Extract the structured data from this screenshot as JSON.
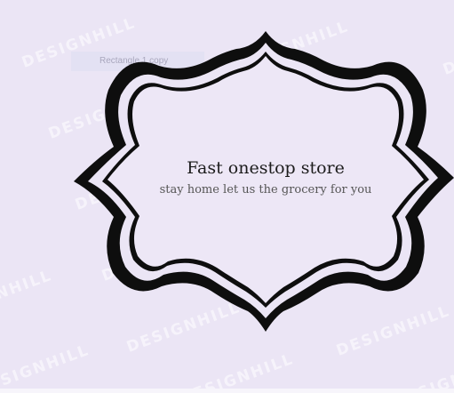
{
  "colors": {
    "background": "#ebe5f5",
    "frame": "#0e0e0e",
    "inner": "#ede7f6"
  },
  "watermark": "DESIGNHILL",
  "layer_chip": {
    "label": "Rectangle 1 copy"
  },
  "badge": {
    "title": "Fast onestop store",
    "subtitle": "stay home let us the grocery for you"
  }
}
